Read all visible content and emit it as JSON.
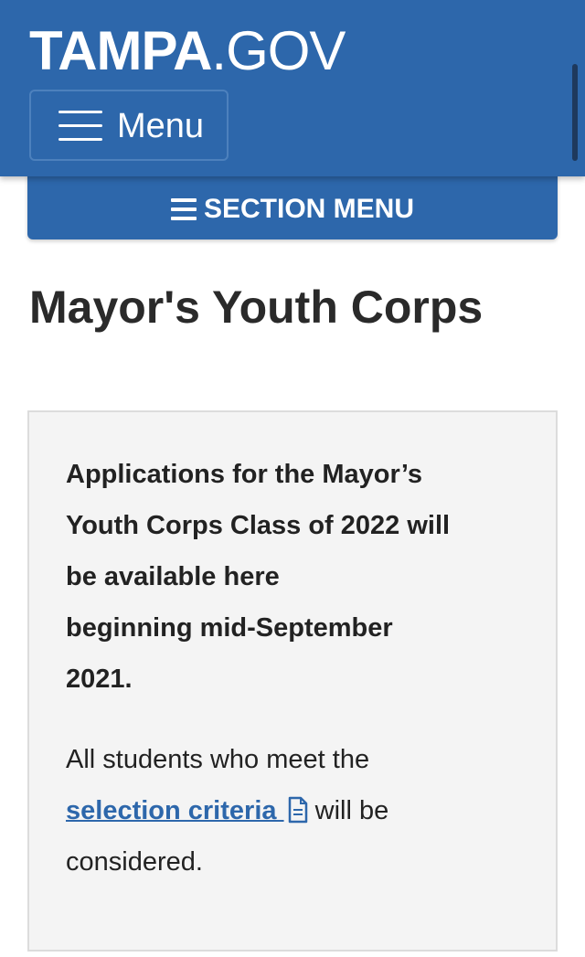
{
  "header": {
    "logo_bold": "TAMPA",
    "logo_light": ".GOV",
    "menu_label": "Menu"
  },
  "section_menu": {
    "label": "SECTION MENU",
    "icon": "hamburger-icon"
  },
  "page": {
    "title": "Mayor's Youth Corps"
  },
  "callout": {
    "bold_lines": [
      "Applications for the Mayor’s",
      "Youth Corps Class of 2022 will",
      "be available here",
      "beginning mid-September",
      "2021."
    ],
    "text_line1": "All students who meet the",
    "link_text": "selection criteria",
    "link_icon": "document-icon",
    "text_after_link": "will be",
    "text_line3": "considered."
  },
  "colors": {
    "brand_blue": "#2d67ab",
    "panel_bg": "#f4f4f4",
    "text": "#222222"
  }
}
